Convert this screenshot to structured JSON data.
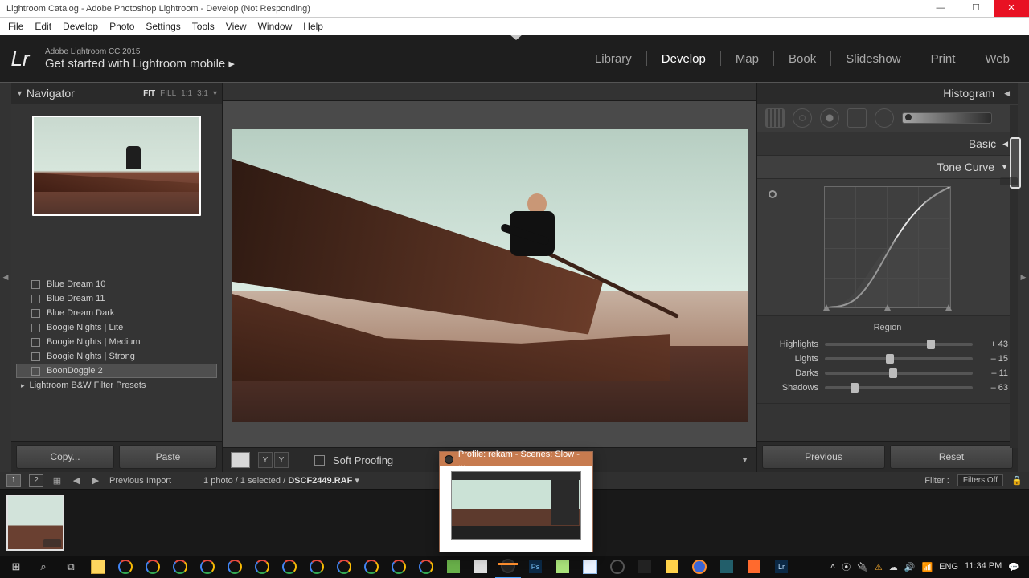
{
  "window": {
    "title": "Lightroom Catalog - Adobe Photoshop Lightroom - Develop (Not Responding)"
  },
  "menubar": [
    "File",
    "Edit",
    "Develop",
    "Photo",
    "Settings",
    "Tools",
    "View",
    "Window",
    "Help"
  ],
  "identity": {
    "small": "Adobe Lightroom CC 2015",
    "big": "Get started with Lightroom mobile  ▸"
  },
  "modules": [
    {
      "label": "Library",
      "active": false
    },
    {
      "label": "Develop",
      "active": true
    },
    {
      "label": "Map",
      "active": false
    },
    {
      "label": "Book",
      "active": false
    },
    {
      "label": "Slideshow",
      "active": false
    },
    {
      "label": "Print",
      "active": false
    },
    {
      "label": "Web",
      "active": false
    }
  ],
  "navigator": {
    "title": "Navigator",
    "zooms": [
      {
        "l": "FIT",
        "a": true
      },
      {
        "l": "FILL"
      },
      {
        "l": "1:1"
      },
      {
        "l": "3:1"
      },
      {
        "l": "▾"
      }
    ]
  },
  "presets": [
    {
      "label": "Blue Dream 10"
    },
    {
      "label": "Blue Dream 11"
    },
    {
      "label": "Blue Dream Dark"
    },
    {
      "label": "Boogie Nights | Lite"
    },
    {
      "label": "Boogie Nights | Medium"
    },
    {
      "label": "Boogie Nights | Strong"
    },
    {
      "label": "BoonDoggle 2",
      "selected": true
    }
  ],
  "presetFolder": {
    "label": "Lightroom B&W Filter Presets"
  },
  "leftButtons": {
    "copy": "Copy...",
    "paste": "Paste"
  },
  "toolbar": {
    "soft": "Soft Proofing"
  },
  "right": {
    "histogram": "Histogram",
    "basic": "Basic",
    "tone": "Tone Curve",
    "region": "Region",
    "sliders": [
      {
        "name": "Highlights",
        "value": "+ 43",
        "pos": 72
      },
      {
        "name": "Lights",
        "value": "– 15",
        "pos": 44
      },
      {
        "name": "Darks",
        "value": "– 11",
        "pos": 46
      },
      {
        "name": "Shadows",
        "value": "– 63",
        "pos": 20
      }
    ],
    "prev": "Previous",
    "reset": "Reset"
  },
  "film": {
    "pages": [
      "1",
      "2"
    ],
    "prevImport": "Previous Import",
    "status": "1 photo / 1 selected /",
    "filename": "DSCF2449.RAF",
    "filterLabel": "Filter :",
    "filterValue": "Filters Off"
  },
  "taskPreview": {
    "title": "Profile: rekam - Scenes: Slow - ..."
  },
  "systray": {
    "lang": "ENG",
    "time": "11:34 PM"
  }
}
